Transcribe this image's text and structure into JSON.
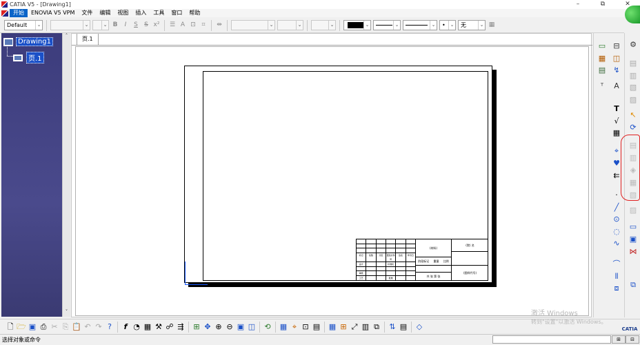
{
  "window": {
    "title": "CATIA V5 - [Drawing1]",
    "min": "–",
    "restore": "⧉",
    "close": "✕"
  },
  "menu": {
    "items": [
      "开始",
      "ENOVIA V5 VPM",
      "文件",
      "编辑",
      "视图",
      "插入",
      "工具",
      "窗口",
      "帮助"
    ]
  },
  "format_toolbar": {
    "style_value": "Default",
    "none_label": "无",
    "dot_label": "•"
  },
  "tree": {
    "root": "Drawing1",
    "child": "页.1"
  },
  "sheet": {
    "tab_label": "页.1"
  },
  "title_block": {
    "company": "(院)  名",
    "drawing_no": "(图样代号)",
    "material": "(材料)",
    "scale_row": [
      "阶段标记",
      "重量",
      "比例"
    ],
    "sheet_row": "共  张  第  张",
    "grid_labels": [
      "标记",
      "处数",
      "分区",
      "更改文件号",
      "签名",
      "年月日",
      "设计",
      "标准化",
      "审核",
      "工艺",
      "批准"
    ]
  },
  "status": {
    "prompt": "选择对象或命令"
  },
  "watermark": {
    "line1": "激活 Windows",
    "line2": "转到\"设置\"以激活 Windows。"
  },
  "logo": {
    "text": "CATIA"
  },
  "colors": {
    "tree_bg": "#3c3c7c",
    "selection": "#1a50c8",
    "annotation": "#e02020",
    "axis": "#1a5aff"
  },
  "icons": {
    "right_col1": [
      "frame-icon",
      "view-icon",
      "section-icon",
      "detail-icon",
      "text-icon",
      "balloon-icon",
      "table-icon",
      "point-icon",
      "pattern-icon",
      "arrow-icon",
      "line-icon",
      "circle-icon",
      "spline-icon",
      "curve-icon",
      "chamfer-icon",
      "dimension-icon"
    ],
    "right_col2": [
      "select-icon",
      "sketcher-icon",
      "disabled-a-icon",
      "disabled-b-icon",
      "disabled-c-icon",
      "disabled-d-icon",
      "disabled-e-icon",
      "rectangle-icon",
      "grid-icon",
      "constraint-icon",
      "window-icon"
    ],
    "bottom": [
      "new-icon",
      "open-icon",
      "save-icon",
      "print-icon",
      "cut-icon",
      "copy-icon",
      "paste-icon",
      "undo-icon",
      "redo-icon",
      "help-icon",
      "formula-icon",
      "knowledge-icon",
      "table-icon",
      "tools-icon",
      "catalog-icon",
      "fit-icon",
      "pan-icon",
      "zoom-in-icon",
      "zoom-out-icon",
      "zoom-area-icon",
      "normal-view-icon",
      "update-icon",
      "grid-icon",
      "snap-icon",
      "analysis-icon",
      "calc-icon",
      "measure-icon",
      "sketch-icon",
      "filter-icon",
      "cursor-icon",
      "view-icon",
      "layer-icon"
    ]
  }
}
